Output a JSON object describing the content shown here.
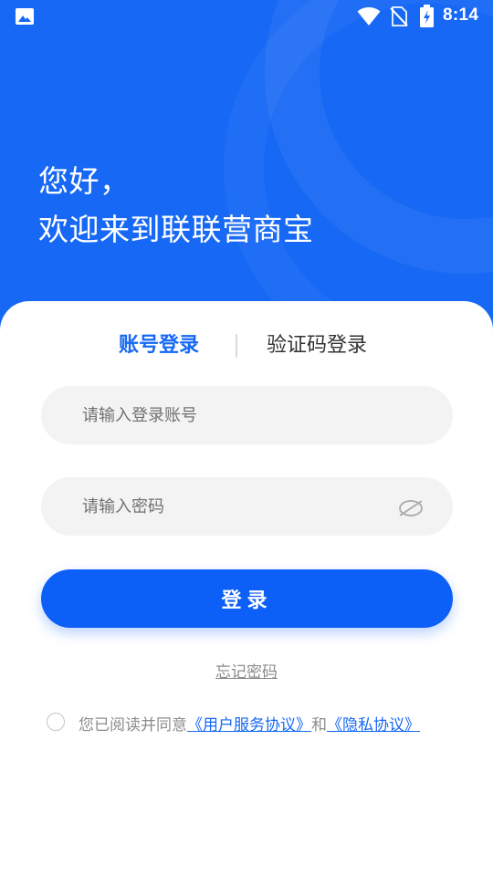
{
  "status_bar": {
    "time": "8:14",
    "icons": [
      "gallery-icon",
      "wifi-icon",
      "no-sim-icon",
      "battery-charging-icon"
    ]
  },
  "greeting": {
    "line1": "您好，",
    "line2": "欢迎来到联联营商宝"
  },
  "tabs": {
    "account_login": "账号登录",
    "code_login": "验证码登录",
    "active": "account_login"
  },
  "form": {
    "username": {
      "value": "",
      "placeholder": "请输入登录账号"
    },
    "password": {
      "value": "",
      "placeholder": "请输入密码",
      "icon": "eye-off-icon"
    }
  },
  "login_button": "登录",
  "forgot_password": "忘记密码",
  "agreement": {
    "checked": false,
    "prefix": "您已阅读并同意",
    "user_service_agreement": "《用户服务协议》",
    "conjunction": "和",
    "privacy_agreement": "《隐私协议》"
  },
  "colors": {
    "brand": "#1668f5",
    "button": "#0d60f7",
    "input_bg": "#f3f3f3",
    "muted_text": "#8c8c8c"
  }
}
